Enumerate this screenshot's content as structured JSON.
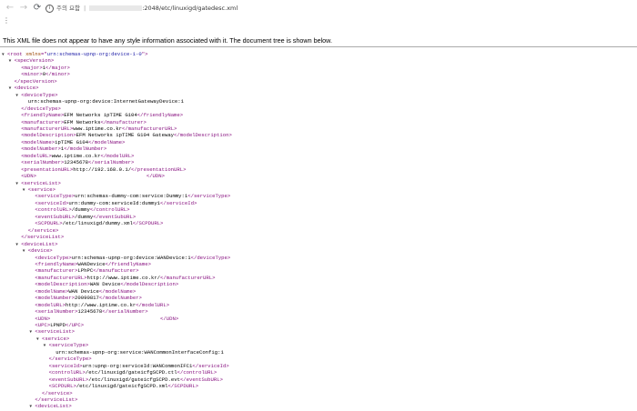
{
  "toolbar": {
    "back_icon": "←",
    "forward_icon": "→",
    "reload_icon": "⟳",
    "security_label": "주의 요함",
    "url_separator": "|",
    "url_path": ":2048/etc/linuxigd/gatedesc.xml",
    "menu_icon": "⋮"
  },
  "notice": "This XML file does not appear to have any style information associated with it. The document tree is shown below.",
  "xml_lines": [
    {
      "d": 0,
      "t": 1,
      "h": [
        [
          "tg",
          "<root "
        ],
        [
          "an",
          "xmlns"
        ],
        [
          "tg",
          "=\""
        ],
        [
          "av",
          "urn:schemas-upnp-org:device-1-0"
        ],
        [
          "tg",
          "\">"
        ]
      ]
    },
    {
      "d": 1,
      "t": 1,
      "h": [
        [
          "tg",
          "<specVersion>"
        ]
      ]
    },
    {
      "d": 2,
      "t": 0,
      "h": [
        [
          "tg",
          "<major>"
        ],
        [
          "tx",
          "1"
        ],
        [
          "tg",
          "</major>"
        ]
      ]
    },
    {
      "d": 2,
      "t": 0,
      "h": [
        [
          "tg",
          "<minor>"
        ],
        [
          "tx",
          "0"
        ],
        [
          "tg",
          "</minor>"
        ]
      ]
    },
    {
      "d": 1,
      "t": 0,
      "h": [
        [
          "tg",
          "</specVersion>"
        ]
      ]
    },
    {
      "d": 1,
      "t": 1,
      "h": [
        [
          "tg",
          "<device>"
        ]
      ]
    },
    {
      "d": 2,
      "t": 1,
      "h": [
        [
          "tg",
          "<deviceType>"
        ]
      ]
    },
    {
      "d": 3,
      "t": 0,
      "h": [
        [
          "tx",
          "urn:schemas-upnp-org:device:InternetGatewayDevice:1"
        ]
      ]
    },
    {
      "d": 2,
      "t": 0,
      "h": [
        [
          "tg",
          "</deviceType>"
        ]
      ]
    },
    {
      "d": 2,
      "t": 0,
      "h": [
        [
          "tg",
          "<friendlyName>"
        ],
        [
          "tx",
          "EFM Networks ipTIME G104"
        ],
        [
          "tg",
          "</friendlyName>"
        ]
      ]
    },
    {
      "d": 2,
      "t": 0,
      "h": [
        [
          "tg",
          "<manufacturer>"
        ],
        [
          "tx",
          "EFM Networks"
        ],
        [
          "tg",
          "</manufacturer>"
        ]
      ]
    },
    {
      "d": 2,
      "t": 0,
      "h": [
        [
          "tg",
          "<manufacturerURL>"
        ],
        [
          "tx",
          "www.iptime.co.kr"
        ],
        [
          "tg",
          "</manufacturerURL>"
        ]
      ]
    },
    {
      "d": 2,
      "t": 0,
      "h": [
        [
          "tg",
          "<modelDescription>"
        ],
        [
          "tx",
          "EFM Networks ipTIME G104 Gateway"
        ],
        [
          "tg",
          "</modelDescription>"
        ]
      ]
    },
    {
      "d": 2,
      "t": 0,
      "h": [
        [
          "tg",
          "<modelName>"
        ],
        [
          "tx",
          "ipTIME G104"
        ],
        [
          "tg",
          "</modelName>"
        ]
      ]
    },
    {
      "d": 2,
      "t": 0,
      "h": [
        [
          "tg",
          "<modelNumber>"
        ],
        [
          "tx",
          "1"
        ],
        [
          "tg",
          "</modelNumber>"
        ]
      ]
    },
    {
      "d": 2,
      "t": 0,
      "h": [
        [
          "tg",
          "<modelURL>"
        ],
        [
          "tx",
          "www.iptime.co.kr"
        ],
        [
          "tg",
          "</modelURL>"
        ]
      ]
    },
    {
      "d": 2,
      "t": 0,
      "h": [
        [
          "tg",
          "<serialNumber>"
        ],
        [
          "tx",
          "12345678"
        ],
        [
          "tg",
          "</serialNumber>"
        ]
      ]
    },
    {
      "d": 2,
      "t": 0,
      "h": [
        [
          "tg",
          "<presentationURL>"
        ],
        [
          "tx",
          "http://192.168.0.1/"
        ],
        [
          "tg",
          "</presentationURL>"
        ]
      ]
    },
    {
      "d": 2,
      "t": 0,
      "h": [
        [
          "tg",
          "<UDN>"
        ],
        [
          "tx",
          "                                    "
        ],
        [
          "tg",
          "</UDN>"
        ]
      ]
    },
    {
      "d": 2,
      "t": 1,
      "h": [
        [
          "tg",
          "<serviceList>"
        ]
      ]
    },
    {
      "d": 3,
      "t": 1,
      "h": [
        [
          "tg",
          "<service>"
        ]
      ]
    },
    {
      "d": 4,
      "t": 0,
      "h": [
        [
          "tg",
          "<serviceType>"
        ],
        [
          "tx",
          "urn:schemas-dummy-com:service:Dummy:1"
        ],
        [
          "tg",
          "</serviceType>"
        ]
      ]
    },
    {
      "d": 4,
      "t": 0,
      "h": [
        [
          "tg",
          "<serviceId>"
        ],
        [
          "tx",
          "urn:dummy-com:serviceId:dummy1"
        ],
        [
          "tg",
          "</serviceId>"
        ]
      ]
    },
    {
      "d": 4,
      "t": 0,
      "h": [
        [
          "tg",
          "<controlURL>"
        ],
        [
          "tx",
          "/dummy"
        ],
        [
          "tg",
          "</controlURL>"
        ]
      ]
    },
    {
      "d": 4,
      "t": 0,
      "h": [
        [
          "tg",
          "<eventSubURL>"
        ],
        [
          "tx",
          "/dummy"
        ],
        [
          "tg",
          "</eventSubURL>"
        ]
      ]
    },
    {
      "d": 4,
      "t": 0,
      "h": [
        [
          "tg",
          "<SCPDURL>"
        ],
        [
          "tx",
          "/etc/linuxigd/dummy.xml"
        ],
        [
          "tg",
          "</SCPDURL>"
        ]
      ]
    },
    {
      "d": 3,
      "t": 0,
      "h": [
        [
          "tg",
          "</service>"
        ]
      ]
    },
    {
      "d": 2,
      "t": 0,
      "h": [
        [
          "tg",
          "</serviceList>"
        ]
      ]
    },
    {
      "d": 2,
      "t": 1,
      "h": [
        [
          "tg",
          "<deviceList>"
        ]
      ]
    },
    {
      "d": 3,
      "t": 1,
      "h": [
        [
          "tg",
          "<device>"
        ]
      ]
    },
    {
      "d": 4,
      "t": 0,
      "h": [
        [
          "tg",
          "<deviceType>"
        ],
        [
          "tx",
          "urn:schemas-upnp-org:device:WANDevice:1"
        ],
        [
          "tg",
          "</deviceType>"
        ]
      ]
    },
    {
      "d": 4,
      "t": 0,
      "h": [
        [
          "tg",
          "<friendlyName>"
        ],
        [
          "tx",
          "WANDevice"
        ],
        [
          "tg",
          "</friendlyName>"
        ]
      ]
    },
    {
      "d": 4,
      "t": 0,
      "h": [
        [
          "tg",
          "<manufacturer>"
        ],
        [
          "tx",
          "LPhPC"
        ],
        [
          "tg",
          "</manufacturer>"
        ]
      ]
    },
    {
      "d": 4,
      "t": 0,
      "h": [
        [
          "tg",
          "<manufacturerURL>"
        ],
        [
          "tx",
          "http://www.iptime.co.kr/"
        ],
        [
          "tg",
          "</manufacturerURL>"
        ]
      ]
    },
    {
      "d": 4,
      "t": 0,
      "h": [
        [
          "tg",
          "<modelDescription>"
        ],
        [
          "tx",
          "WAN Device"
        ],
        [
          "tg",
          "</modelDescription>"
        ]
      ]
    },
    {
      "d": 4,
      "t": 0,
      "h": [
        [
          "tg",
          "<modelName>"
        ],
        [
          "tx",
          "WAN Device"
        ],
        [
          "tg",
          "</modelName>"
        ]
      ]
    },
    {
      "d": 4,
      "t": 0,
      "h": [
        [
          "tg",
          "<modelNumber>"
        ],
        [
          "tx",
          "20090817"
        ],
        [
          "tg",
          "</modelNumber>"
        ]
      ]
    },
    {
      "d": 4,
      "t": 0,
      "h": [
        [
          "tg",
          "<modelURL>"
        ],
        [
          "tx",
          "http://www.iptime.co.kr"
        ],
        [
          "tg",
          "</modelURL>"
        ]
      ]
    },
    {
      "d": 4,
      "t": 0,
      "h": [
        [
          "tg",
          "<serialNumber>"
        ],
        [
          "tx",
          "12345678"
        ],
        [
          "tg",
          "</serialNumber>"
        ]
      ]
    },
    {
      "d": 4,
      "t": 0,
      "h": [
        [
          "tg",
          "<UDN>"
        ],
        [
          "tx",
          "                                    "
        ],
        [
          "tg",
          "</UDN>"
        ]
      ]
    },
    {
      "d": 4,
      "t": 0,
      "h": [
        [
          "tg",
          "<UPC>"
        ],
        [
          "tx",
          "LPNPD"
        ],
        [
          "tg",
          "</UPC>"
        ]
      ]
    },
    {
      "d": 4,
      "t": 1,
      "h": [
        [
          "tg",
          "<serviceList>"
        ]
      ]
    },
    {
      "d": 5,
      "t": 1,
      "h": [
        [
          "tg",
          "<service>"
        ]
      ]
    },
    {
      "d": 6,
      "t": 1,
      "h": [
        [
          "tg",
          "<serviceType>"
        ]
      ]
    },
    {
      "d": 7,
      "t": 0,
      "h": [
        [
          "tx",
          "urn:schemas-upnp-org:service:WANCommonInterfaceConfig:1"
        ]
      ]
    },
    {
      "d": 6,
      "t": 0,
      "h": [
        [
          "tg",
          "</serviceType>"
        ]
      ]
    },
    {
      "d": 6,
      "t": 0,
      "h": [
        [
          "tg",
          "<serviceId>"
        ],
        [
          "tx",
          "urn:upnp-org:serviceId:WANCommonIFC1"
        ],
        [
          "tg",
          "</serviceId>"
        ]
      ]
    },
    {
      "d": 6,
      "t": 0,
      "h": [
        [
          "tg",
          "<controlURL>"
        ],
        [
          "tx",
          "/etc/linuxigd/gateicfgSCPD.ctl"
        ],
        [
          "tg",
          "</controlURL>"
        ]
      ]
    },
    {
      "d": 6,
      "t": 0,
      "h": [
        [
          "tg",
          "<eventSubURL>"
        ],
        [
          "tx",
          "/etc/linuxigd/gateicfgSCPD.evt"
        ],
        [
          "tg",
          "</eventSubURL>"
        ]
      ]
    },
    {
      "d": 6,
      "t": 0,
      "h": [
        [
          "tg",
          "<SCPDURL>"
        ],
        [
          "tx",
          "/etc/linuxigd/gateicfgSCPD.xml"
        ],
        [
          "tg",
          "</SCPDURL>"
        ]
      ]
    },
    {
      "d": 5,
      "t": 0,
      "h": [
        [
          "tg",
          "</service>"
        ]
      ]
    },
    {
      "d": 4,
      "t": 0,
      "h": [
        [
          "tg",
          "</serviceList>"
        ]
      ]
    },
    {
      "d": 4,
      "t": 1,
      "h": [
        [
          "tg",
          "<deviceList>"
        ]
      ]
    }
  ]
}
